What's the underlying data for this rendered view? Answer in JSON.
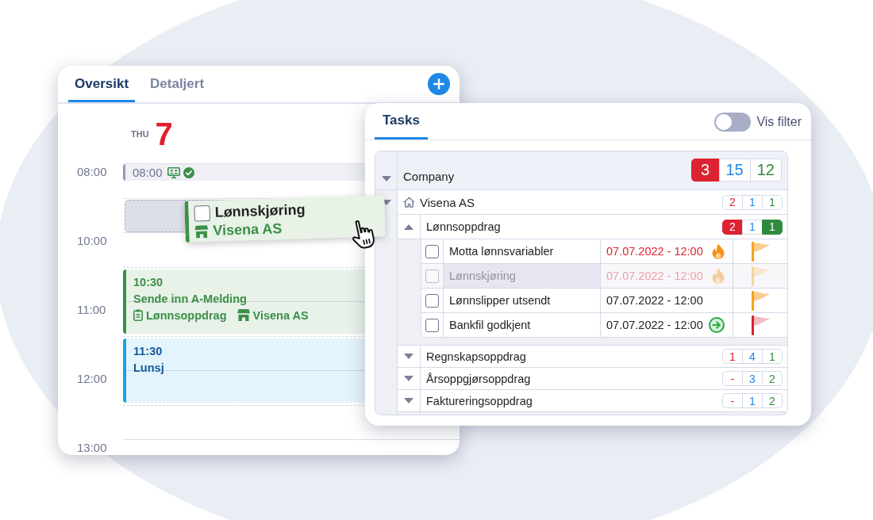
{
  "calendar": {
    "tabs": [
      {
        "label": "Oversikt",
        "selected": true
      },
      {
        "label": "Detaljert",
        "selected": false
      }
    ],
    "day": {
      "weekday": "THU",
      "date": "7"
    },
    "time_labels": [
      "08:00",
      "10:00",
      "11:00",
      "12:00",
      "13:00"
    ],
    "events": [
      {
        "kind": "compact",
        "time": "08:00",
        "color": "#9497b5"
      },
      {
        "kind": "placeholder"
      },
      {
        "kind": "task",
        "time": "10:30",
        "title": "Sende inn A-Melding",
        "assignment": "Lønnsoppdrag",
        "company": "Visena AS",
        "color": "#3a8f46"
      },
      {
        "kind": "block",
        "time": "11:30",
        "title": "Lunsj",
        "color": "#1aa0e6"
      }
    ]
  },
  "drag_card": {
    "title": "Lønnskjøring",
    "company": "Visena AS",
    "checked": false
  },
  "tasks": {
    "tab": {
      "label": "Tasks",
      "selected": true
    },
    "filter_toggle": {
      "label": "Vis filter",
      "on": false
    },
    "table": {
      "header": {
        "label": "Company",
        "counts": [
          {
            "kind": "overdue",
            "value": "3",
            "filled": true
          },
          {
            "kind": "open",
            "value": "15",
            "filled": false
          },
          {
            "kind": "done",
            "value": "12",
            "filled": false
          }
        ]
      },
      "companies": [
        {
          "name": "Visena AS",
          "counts": [
            {
              "kind": "overdue",
              "value": "2",
              "filled": false
            },
            {
              "kind": "open",
              "value": "1",
              "filled": false
            },
            {
              "kind": "done",
              "value": "1",
              "filled": false
            }
          ],
          "assignments": [
            {
              "name": "Lønnsoppdrag",
              "expanded": true,
              "counts": [
                {
                  "kind": "overdue",
                  "value": "2",
                  "filled": true
                },
                {
                  "kind": "open",
                  "value": "1",
                  "filled": false
                },
                {
                  "kind": "done",
                  "value": "1",
                  "filled": true
                }
              ],
              "tasks": [
                {
                  "name": "Motta lønnsvariabler",
                  "checked": false,
                  "due": "07.07.2022 - 12:00",
                  "overdue": true,
                  "dragging": false,
                  "urgent": true,
                  "follow_up": false,
                  "high_priority": false
                },
                {
                  "name": "Lønnskjøring",
                  "checked": false,
                  "due": "07.07.2022 - 12:00",
                  "overdue": true,
                  "dragging": true,
                  "urgent": true,
                  "follow_up": false,
                  "high_priority": false
                },
                {
                  "name": "Lønnslipper utsendt",
                  "checked": false,
                  "due": "07.07.2022 - 12:00",
                  "overdue": false,
                  "dragging": false,
                  "urgent": false,
                  "follow_up": false,
                  "high_priority": false
                },
                {
                  "name": "Bankfil godkjent",
                  "checked": false,
                  "due": "07.07.2022 - 12:00",
                  "overdue": false,
                  "dragging": false,
                  "urgent": false,
                  "follow_up": true,
                  "high_priority": true
                }
              ]
            },
            {
              "name": "Regnskapsoppdrag",
              "expanded": false,
              "counts": [
                {
                  "kind": "overdue",
                  "value": "1",
                  "filled": false
                },
                {
                  "kind": "open",
                  "value": "4",
                  "filled": false
                },
                {
                  "kind": "done",
                  "value": "1",
                  "filled": false
                }
              ]
            },
            {
              "name": "Årsoppgjørsoppdrag",
              "expanded": false,
              "counts": [
                {
                  "kind": "overdue",
                  "value": "-",
                  "filled": false
                },
                {
                  "kind": "open",
                  "value": "3",
                  "filled": false
                },
                {
                  "kind": "done",
                  "value": "2",
                  "filled": false
                }
              ]
            },
            {
              "name": "Faktureringsoppdrag",
              "expanded": false,
              "counts": [
                {
                  "kind": "overdue",
                  "value": "-",
                  "filled": false
                },
                {
                  "kind": "open",
                  "value": "1",
                  "filled": false
                },
                {
                  "kind": "done",
                  "value": "2",
                  "filled": false
                }
              ]
            }
          ]
        }
      ]
    }
  }
}
